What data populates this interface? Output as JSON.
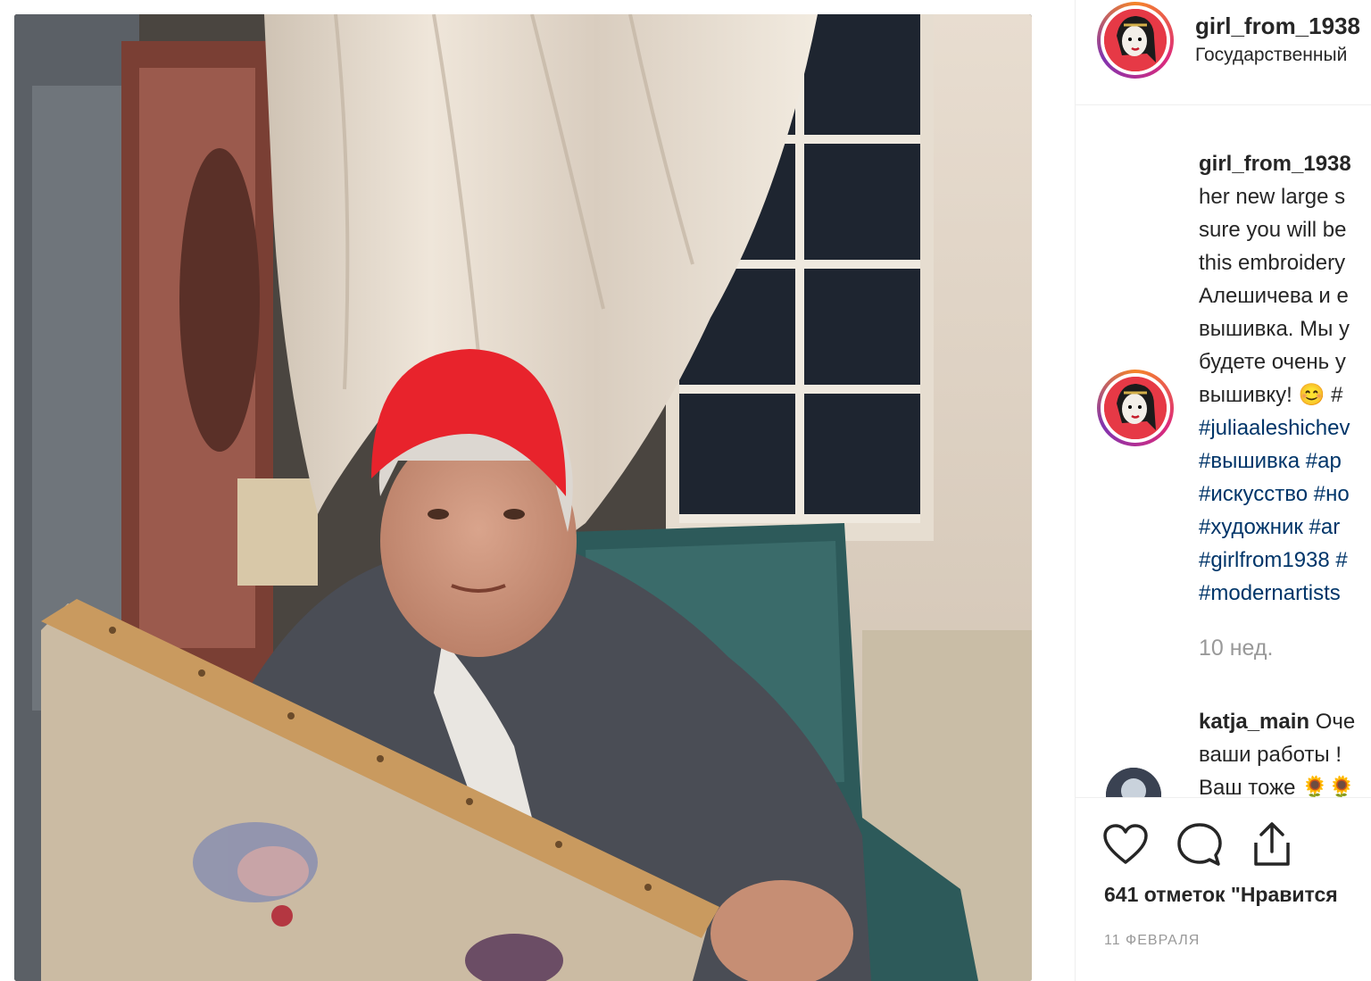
{
  "post": {
    "username": "girl_from_1938",
    "location": "Государственный",
    "caption_lines": [
      "her new large s",
      "sure you will be",
      "this embroidery",
      "Алешичева и е",
      "вышивка. Мы у",
      "будете очень у",
      "вышивку! 😊 #"
    ],
    "hashtag_lines": [
      "#juliaaleshichev",
      "#вышивка #ар",
      "#искусство #но",
      "#художник #ar",
      "#girlfrom1938 #",
      "#modernartists"
    ],
    "time_ago": "10 нед.",
    "likes": "641 отметок \"Нравится",
    "date": "11 ФЕВРАЛЯ"
  },
  "comment": {
    "username": "katja_main",
    "text_first": "Оче",
    "line2": "ваши работы !",
    "line3": "Ваш тоже 🌻🌻"
  },
  "icons": {
    "like": "heart-icon",
    "comment": "comment-icon",
    "share": "share-icon"
  },
  "colors": {
    "link": "#003569",
    "muted": "#999999",
    "text": "#262626"
  }
}
